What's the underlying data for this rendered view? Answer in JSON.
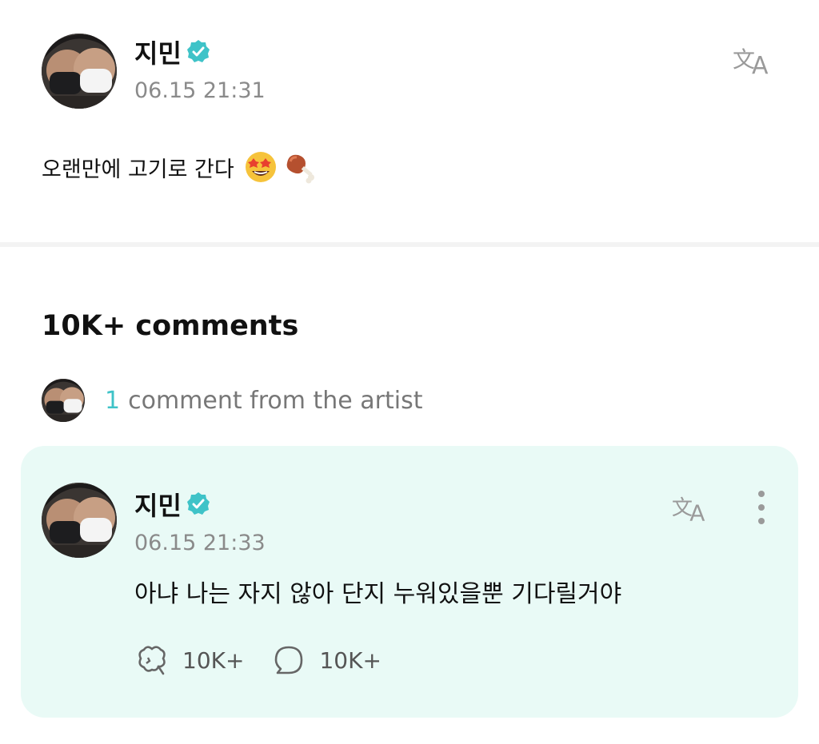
{
  "post": {
    "author": "지민",
    "timestamp": "06.15 21:31",
    "text": "오랜만에 고기로 간다",
    "emojis": [
      "star-struck-emoji",
      "meat-on-bone-emoji"
    ]
  },
  "comments": {
    "title": "10K+ comments",
    "artist_count": "1",
    "artist_text": "comment from the artist"
  },
  "artist_comment": {
    "author": "지민",
    "timestamp": "06.15 21:33",
    "text": "아냐 나는 자지 않아 단지 누워있을뿐 기다릴거야",
    "likes": "10K+",
    "replies": "10K+"
  },
  "colors": {
    "accent": "#3fc3c8",
    "card_bg": "#e9faf6",
    "muted": "#8a8a8a"
  }
}
